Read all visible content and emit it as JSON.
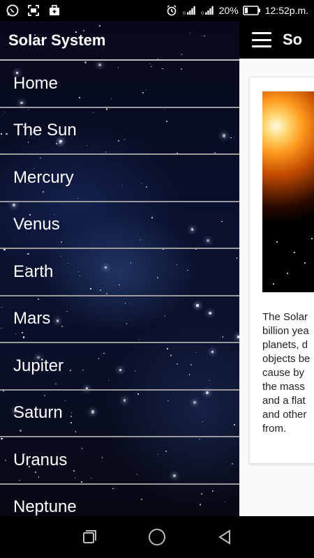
{
  "status_bar": {
    "battery": "20%",
    "time": "12:52p.m.",
    "icons": [
      "whatsapp-icon",
      "scan-icon",
      "briefcase-icon",
      "alarm-icon",
      "signal-icon",
      "signal-icon",
      "battery-icon"
    ]
  },
  "drawer": {
    "title": "Solar System",
    "items": [
      {
        "label": "Home"
      },
      {
        "label": "The Sun"
      },
      {
        "label": "Mercury"
      },
      {
        "label": "Venus"
      },
      {
        "label": "Earth"
      },
      {
        "label": "Mars"
      },
      {
        "label": "Jupiter"
      },
      {
        "label": "Saturn"
      },
      {
        "label": "Uranus"
      },
      {
        "label": "Neptune"
      }
    ]
  },
  "main": {
    "title": "So",
    "card_text": "The Solar\nbillion yea\nplanets, d\nobjects be\ncause by\nthe mass\nand a flat\nand other\nfrom."
  },
  "nav_bar": {
    "icons": [
      "recent-apps-icon",
      "home-icon",
      "back-icon"
    ]
  }
}
